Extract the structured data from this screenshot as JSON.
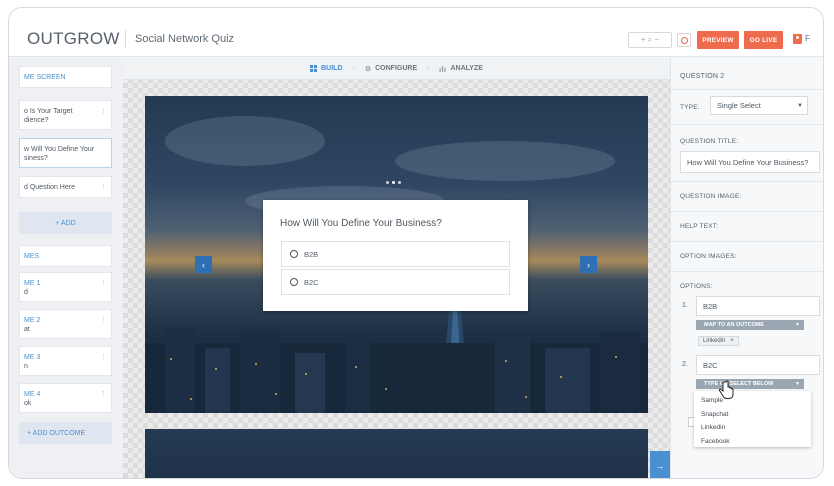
{
  "header": {
    "logo": "OUTGROW",
    "quiz_title": "Social Network Quiz",
    "zoom_controls": "+ ⌕ −",
    "preview_label": "PREVIEW",
    "golive_label": "GO LIVE",
    "user_initial": "F"
  },
  "sidebar": {
    "welcome": "ME SCREEN",
    "questions": [
      {
        "line1": "o Is Your Target",
        "line2": "dience?"
      },
      {
        "line1": "w Will You Define Your",
        "line2": "siness?"
      },
      {
        "line1": "d Question Here",
        "line2": ""
      }
    ],
    "add_label": "+ ADD",
    "outcomes_header": "MES",
    "outcomes": [
      {
        "line1": "ME 1",
        "line2": "d"
      },
      {
        "line1": "ME 2",
        "line2": "at"
      },
      {
        "line1": "ME 3",
        "line2": "n"
      },
      {
        "line1": "ME 4",
        "line2": "ok"
      }
    ],
    "add_outcome_label": "+ ADD OUTCOME"
  },
  "tabs": {
    "build": "BUILD",
    "configure": "CONFIGURE",
    "analyze": "ANALYZE"
  },
  "question_card": {
    "title": "How Will You Define Your Business?",
    "options": [
      "B2B",
      "B2C"
    ]
  },
  "panel": {
    "heading": "QUESTION 2",
    "type_label": "TYPE:",
    "type_value": "Single Select",
    "title_label": "QUESTION TITLE:",
    "title_value": "How Will You Define Your Business?",
    "image_label": "QUESTION IMAGE:",
    "help_label": "HELP TEXT:",
    "option_images_label": "OPTION IMAGES:",
    "options_label": "OPTIONS:",
    "option1_num": "1.",
    "option1_value": "B2B",
    "map_outcome": "MAP TO AN OUTCOME",
    "tag_value": "Linkedin",
    "tag_close": "×",
    "option2_num": "2.",
    "option2_value": "B2C",
    "type_select": "TYPE OR SELECT BELOW",
    "dropdown": [
      "Sample",
      "Snapchat",
      "Linkedin",
      "Facebook"
    ]
  },
  "colors": {
    "accent_orange": "#ee6b4d",
    "accent_blue": "#4a8fd0"
  }
}
